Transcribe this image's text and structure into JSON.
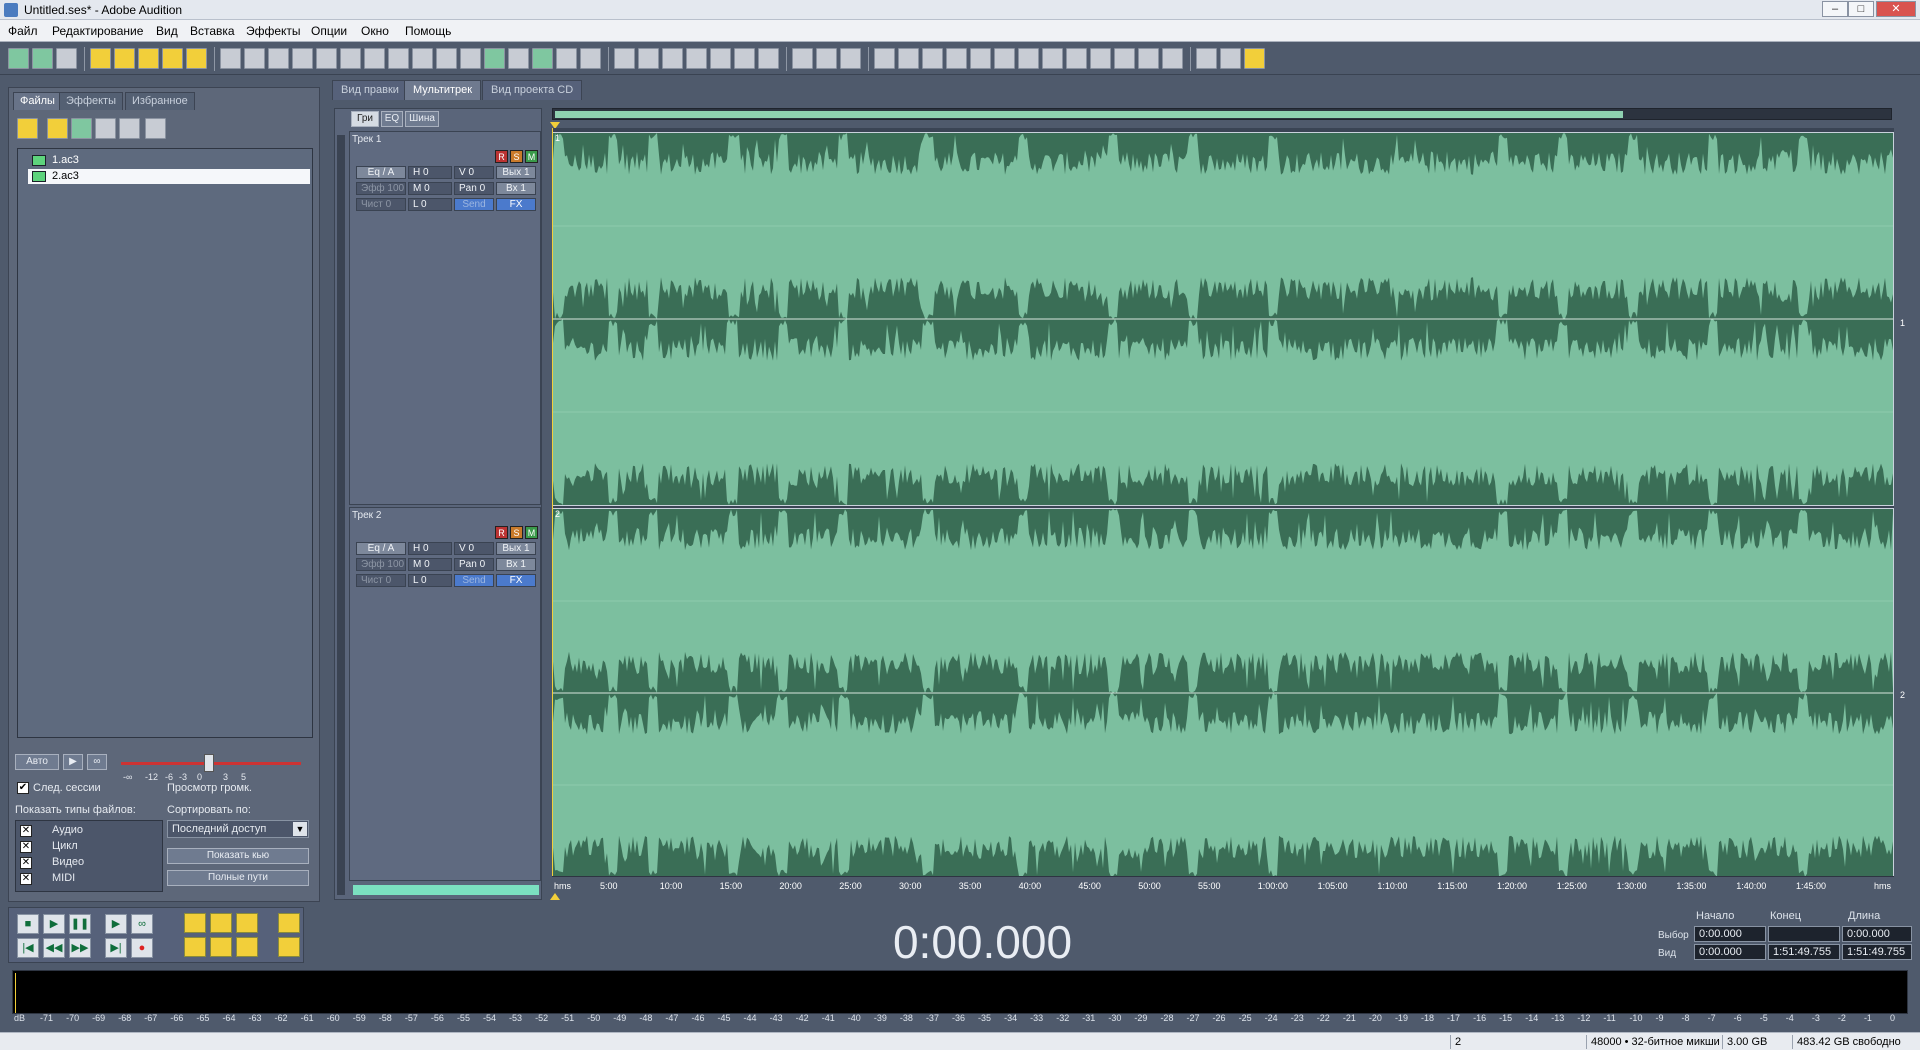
{
  "window": {
    "title": "Untitled.ses* - Adobe Audition"
  },
  "menu": [
    "Файл",
    "Редактирование",
    "Вид",
    "Вставка",
    "Эффекты",
    "Опции",
    "Окно",
    "Помощь"
  ],
  "left_panel": {
    "tabs": [
      "Файлы",
      "Эффекты",
      "Избранное"
    ],
    "files": [
      "1.ac3",
      "2.ac3"
    ],
    "auto_button": "Авто",
    "follow_session": "След. сессии",
    "preview_volume": "Просмотр громк.",
    "volume_scale": [
      "-∞",
      "-12",
      "-6",
      "-3",
      "0",
      "3",
      "5"
    ],
    "show_types_label": "Показать типы файлов:",
    "sort_label": "Сортировать по:",
    "sort_value": "Последний доступ",
    "file_types": [
      "Аудио",
      "Цикл",
      "Видео",
      "MIDI"
    ],
    "show_button": "Показать кью",
    "full_paths_button": "Полные пути"
  },
  "main": {
    "tabs": [
      "Вид правки",
      "Мультитрек",
      "Вид проекта CD"
    ],
    "subtabs": [
      "Гри",
      "EQ",
      "Шина"
    ],
    "tracks": [
      {
        "name": "Трек 1",
        "number": "1"
      },
      {
        "name": "Трек 2",
        "number": "2"
      }
    ],
    "track_cells": {
      "eq": "Eq / A",
      "vol_h": "H 0",
      "vol_v": "V 0",
      "out": "Вых 1",
      "effect": "Эфф 100",
      "m": "M 0",
      "pan": "Pan 0",
      "in": "Вх 1",
      "clean": "Чист 0",
      "l": "L 0",
      "send": "Send",
      "fx": "FX"
    },
    "rsm": [
      "R",
      "S",
      "M"
    ]
  },
  "ruler": [
    "hms",
    "5:00",
    "10:00",
    "15:00",
    "20:00",
    "25:00",
    "30:00",
    "35:00",
    "40:00",
    "45:00",
    "50:00",
    "55:00",
    "1:00:00",
    "1:05:00",
    "1:10:00",
    "1:15:00",
    "1:20:00",
    "1:25:00",
    "1:30:00",
    "1:35:00",
    "1:40:00",
    "1:45:00",
    "hms"
  ],
  "right_scale": [
    "1",
    "2"
  ],
  "transport": {
    "time": "0:00.000"
  },
  "selection": {
    "headers": [
      "Начало",
      "Конец",
      "Длина"
    ],
    "row1_label": "Выбор",
    "row2_label": "Вид",
    "sel_start": "0:00.000",
    "sel_end": "",
    "sel_len": "0:00.000",
    "view_start": "0:00.000",
    "view_end": "1:51:49.755",
    "view_len": "1:51:49.755"
  },
  "meter_scale": [
    "dB",
    "-71",
    "-70",
    "-69",
    "-68",
    "-67",
    "-66",
    "-65",
    "-64",
    "-63",
    "-62",
    "-61",
    "-60",
    "-59",
    "-58",
    "-57",
    "-56",
    "-55",
    "-54",
    "-53",
    "-52",
    "-51",
    "-50",
    "-49",
    "-48",
    "-47",
    "-46",
    "-45",
    "-44",
    "-43",
    "-42",
    "-41",
    "-40",
    "-39",
    "-38",
    "-37",
    "-36",
    "-35",
    "-34",
    "-33",
    "-32",
    "-31",
    "-30",
    "-29",
    "-28",
    "-27",
    "-26",
    "-25",
    "-24",
    "-23",
    "-22",
    "-21",
    "-20",
    "-19",
    "-18",
    "-17",
    "-16",
    "-15",
    "-14",
    "-13",
    "-12",
    "-11",
    "-10",
    "-9",
    "-8",
    "-7",
    "-6",
    "-5",
    "-4",
    "-3",
    "-2",
    "-1",
    "0"
  ],
  "status": {
    "field1": "2",
    "rate": "48000 • 32-битное микши",
    "size": "3.00 GB",
    "free": "483.42 GB свободно"
  },
  "colors": {
    "wave_light": "#7cbf9f",
    "wave_dark": "#3a6e56",
    "accent": "#8fd1b1"
  }
}
